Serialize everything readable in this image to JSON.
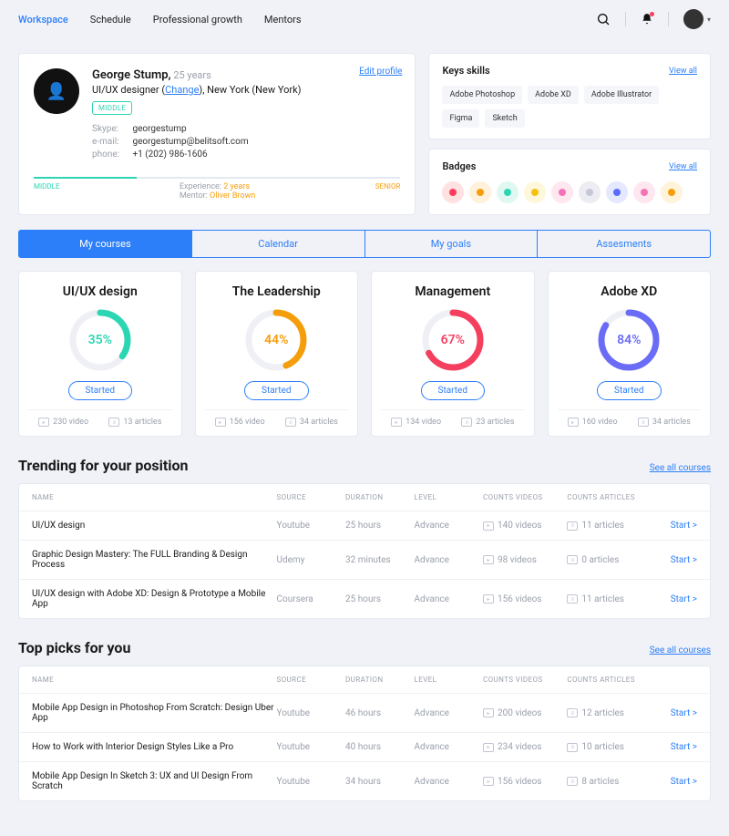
{
  "nav": {
    "items": [
      {
        "label": "Workspace",
        "active": true
      },
      {
        "label": "Schedule",
        "active": false
      },
      {
        "label": "Professional growth",
        "active": false
      },
      {
        "label": "Mentors",
        "active": false
      }
    ]
  },
  "profile": {
    "name": "George Stump,",
    "age": "25 years",
    "role_prefix": "UI/UX designer (",
    "change": "Change",
    "role_suffix": "), New York (New York)",
    "level_badge": "MIDDLE",
    "edit": "Edit profile",
    "skype_lbl": "Skype:",
    "skype": "georgestump",
    "email_lbl": "e-mail:",
    "email": "georgestump@belitsoft.com",
    "phone_lbl": "phone:",
    "phone": "+1 (202) 986-1606",
    "progress": {
      "left": "MIDDLE",
      "right": "SENIOR"
    },
    "exp_lbl": "Experience:",
    "exp_val": "2 years",
    "mentor_lbl": "Mentor:",
    "mentor_val": "Oliver Brown"
  },
  "skills": {
    "title": "Keys skills",
    "view_all": "View all",
    "items": [
      "Adobe Photoshop",
      "Adobe XD",
      "Adobe Illustrator",
      "Figma",
      "Sketch"
    ]
  },
  "badges": {
    "title": "Badges",
    "view_all": "View all",
    "items": [
      {
        "bg": "#ffe1e1",
        "fg": "#ff3b5c"
      },
      {
        "bg": "#fff1dc",
        "fg": "#f59e0b"
      },
      {
        "bg": "#dff9f2",
        "fg": "#2dd6b3"
      },
      {
        "bg": "#fff7dc",
        "fg": "#f5c20b"
      },
      {
        "bg": "#ffe7ef",
        "fg": "#f472b6"
      },
      {
        "bg": "#ececf2",
        "fg": "#c3c8d4"
      },
      {
        "bg": "#e4e9ff",
        "fg": "#5b6cff"
      },
      {
        "bg": "#ffe7ef",
        "fg": "#f472b6"
      },
      {
        "bg": "#fff3dc",
        "fg": "#f59e0b"
      }
    ]
  },
  "tabs": [
    "My courses",
    "Calendar",
    "My goals",
    "Assesments"
  ],
  "active_tab": 0,
  "courses": [
    {
      "title": "UI/UX design",
      "pct": 35,
      "color": "#2dd6b3",
      "btn": "Started",
      "video": "230 video",
      "articles": "13 articles"
    },
    {
      "title": "The Leadership",
      "pct": 44,
      "color": "#f59e0b",
      "btn": "Started",
      "video": "156 video",
      "articles": "34 articles"
    },
    {
      "title": "Management",
      "pct": 67,
      "color": "#f43f5e",
      "btn": "Started",
      "video": "134 video",
      "articles": "23 articles"
    },
    {
      "title": "Adobe XD",
      "pct": 84,
      "color": "#6a6cf6",
      "btn": "Started",
      "video": "160 video",
      "articles": "34 articles"
    }
  ],
  "table_headers": {
    "name": "NAME",
    "source": "SOURCE",
    "duration": "DURATION",
    "level": "LEVEL",
    "videos": "COUNTS VIDEOS",
    "articles": "COUNTS ARTICLES"
  },
  "trending": {
    "title": "Trending for your position",
    "see_all": "See all courses",
    "rows": [
      {
        "name": "UI/UX design",
        "source": "Youtube",
        "duration": "25 hours",
        "level": "Advance",
        "videos": "140 videos",
        "articles": "11 articles",
        "action": "Start  >"
      },
      {
        "name": "Graphic Design Mastery: The FULL Branding & Design Process",
        "source": "Udemy",
        "duration": "32 minutes",
        "level": "Advance",
        "videos": "98 videos",
        "articles": "0 articles",
        "action": "Start  >"
      },
      {
        "name": "UI/UX design with Adobe XD: Design & Prototype a Mobile App",
        "source": "Coursera",
        "duration": "25 hours",
        "level": "Advance",
        "videos": "156 videos",
        "articles": "11 articles",
        "action": "Start  >"
      }
    ]
  },
  "picks": {
    "title": "Top picks for you",
    "see_all": "See all courses",
    "rows": [
      {
        "name": "Mobile App Design in Photoshop From Scratch: Design Uber App",
        "source": "Youtube",
        "duration": "46 hours",
        "level": "Advance",
        "videos": "200 videos",
        "articles": "12 articles",
        "action": "Start  >"
      },
      {
        "name": "How to Work with Interior Design Styles Like a Pro",
        "source": "Youtube",
        "duration": "40 hours",
        "level": "Advance",
        "videos": "234 videos",
        "articles": "10 articles",
        "action": "Start  >"
      },
      {
        "name": "Mobile App Design In Sketch 3: UX and UI Design From Scratch",
        "source": "Youtube",
        "duration": "34 hours",
        "level": "Advance",
        "videos": "156 videos",
        "articles": "8 articles",
        "action": "Start  >"
      }
    ]
  }
}
